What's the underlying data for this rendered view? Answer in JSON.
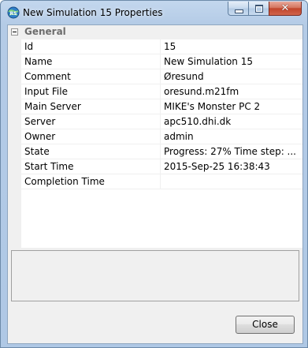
{
  "window": {
    "title": "New Simulation 15 Properties",
    "app_icon": "rs-globe-icon",
    "close_glyph": "✕"
  },
  "category": {
    "label": "General",
    "expanded": true
  },
  "properties": [
    {
      "name": "Id",
      "value": "15"
    },
    {
      "name": "Name",
      "value": "New Simulation 15"
    },
    {
      "name": "Comment",
      "value": "Øresund"
    },
    {
      "name": "Input File",
      "value": "oresund.m21fm"
    },
    {
      "name": "Main Server",
      "value": "MIKE's Monster PC 2"
    },
    {
      "name": "Server",
      "value": "apc510.dhi.dk"
    },
    {
      "name": "Owner",
      "value": "admin"
    },
    {
      "name": "State",
      "value": "Progress: 27%  Time step: ..."
    },
    {
      "name": "Start Time",
      "value": "2015-Sep-25 16:38:43"
    },
    {
      "name": "Completion Time",
      "value": ""
    }
  ],
  "buttons": {
    "close_label": "Close"
  },
  "colors": {
    "frame": "#b4cbe6",
    "close_red": "#c2452c",
    "grid_line": "#f0f0f0"
  }
}
